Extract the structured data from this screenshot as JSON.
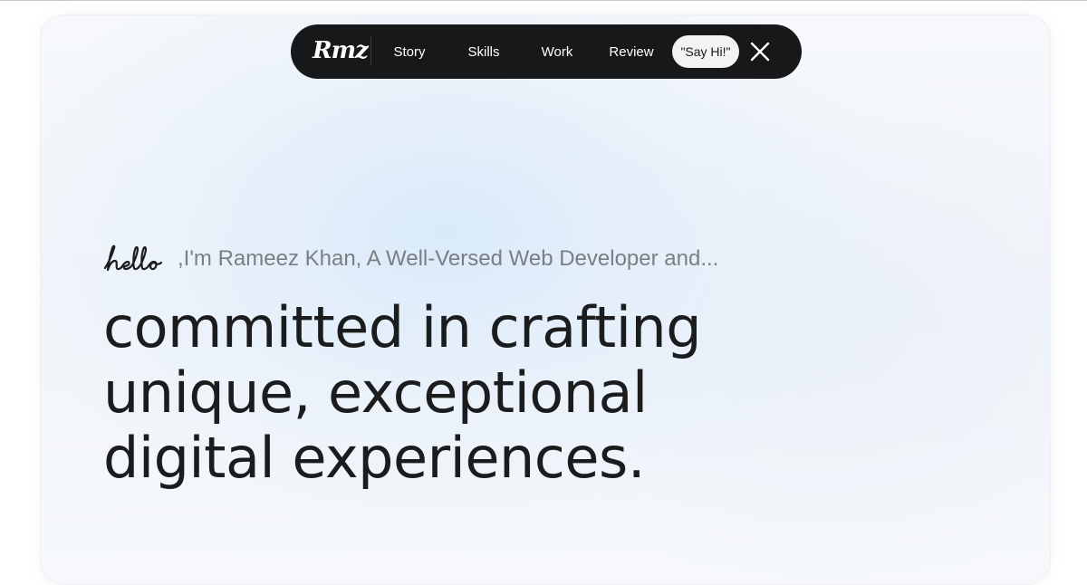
{
  "nav": {
    "logo": "Rmz",
    "links": [
      "Story",
      "Skills",
      "Work",
      "Review"
    ],
    "cta": "\"Say Hi!\"",
    "close_icon": "close-icon"
  },
  "hero": {
    "greeting_script": "hello",
    "intro": ",I'm Rameez Khan, A Well-Versed Web Developer and...",
    "headline_lines": [
      "committed in crafting",
      "unique, exceptional",
      "digital experiences."
    ]
  },
  "colors": {
    "nav_bg": "#17181a",
    "headline": "#1b1c1e",
    "intro": "#7b7e83",
    "cta_bg": "#f3f3f3"
  }
}
